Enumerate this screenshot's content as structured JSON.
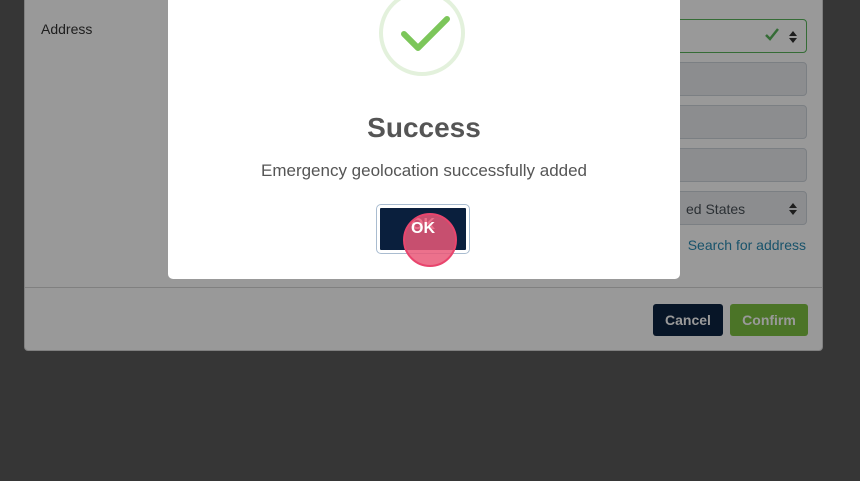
{
  "form": {
    "address_label": "Address",
    "country_value": "ed States",
    "search_link": "Search for address",
    "cancel_label": "Cancel",
    "confirm_label": "Confirm"
  },
  "modal": {
    "title": "Success",
    "message": "Emergency geolocation successfully added",
    "ok_label": "OK",
    "icon": "checkmark-icon"
  },
  "colors": {
    "success_green": "#7dc242",
    "navy": "#0d2341",
    "link_blue": "#2a8bb3",
    "click_indicator": "#e8456d"
  }
}
